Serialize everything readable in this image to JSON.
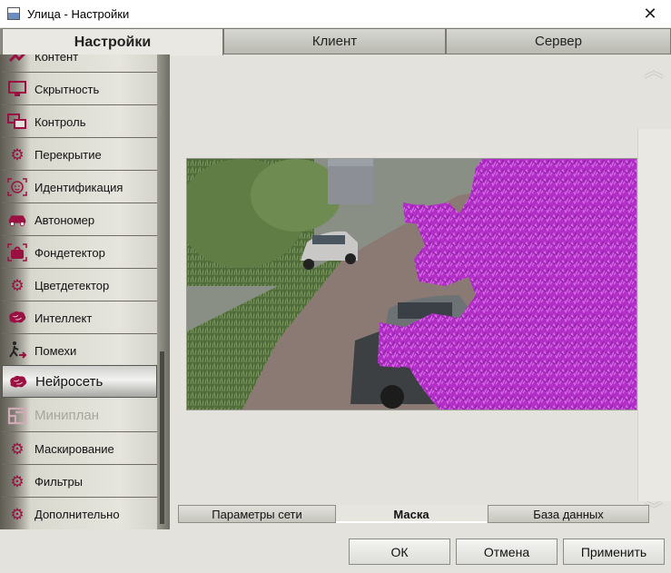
{
  "window": {
    "title": "Улица - Настройки",
    "close_glyph": "✕"
  },
  "top_tabs": [
    {
      "label": "Настройки",
      "active": true
    },
    {
      "label": "Клиент",
      "active": false
    },
    {
      "label": "Сервер",
      "active": false
    }
  ],
  "sidebar": {
    "items": [
      {
        "label": "Контент",
        "icon": "partial-icon",
        "state": "partial"
      },
      {
        "label": "Скрытность",
        "icon": "monitor-icon",
        "state": "normal"
      },
      {
        "label": "Контроль",
        "icon": "screens-icon",
        "state": "normal"
      },
      {
        "label": "Перекрытие",
        "icon": "gear-icon",
        "state": "normal"
      },
      {
        "label": "Идентификация",
        "icon": "face-icon",
        "state": "normal"
      },
      {
        "label": "Автономер",
        "icon": "car-icon",
        "state": "normal"
      },
      {
        "label": "Фондетектор",
        "icon": "bag-icon",
        "state": "normal"
      },
      {
        "label": "Цветдетектор",
        "icon": "gear-icon",
        "state": "normal"
      },
      {
        "label": "Интеллект",
        "icon": "brain-icon",
        "state": "normal"
      },
      {
        "label": "Помехи",
        "icon": "walker-icon",
        "state": "normal"
      },
      {
        "label": "Нейросеть",
        "icon": "brain-icon",
        "state": "active"
      },
      {
        "label": "Миниплан",
        "icon": "plan-icon",
        "state": "disabled"
      },
      {
        "label": "Маскирование",
        "icon": "gear-icon",
        "state": "normal"
      },
      {
        "label": "Фильтры",
        "icon": "gear-icon",
        "state": "normal"
      },
      {
        "label": "Дополнительно",
        "icon": "gear-icon",
        "state": "normal"
      }
    ]
  },
  "sub_tabs": [
    {
      "label": "Параметры сети",
      "active": false
    },
    {
      "label": "Маска",
      "active": true
    },
    {
      "label": "База данных",
      "active": false
    }
  ],
  "buttons": {
    "ok": "ОК",
    "cancel": "Отмена",
    "apply": "Применить"
  },
  "colors": {
    "accent": "#9a1041",
    "mask": "#c23bd8",
    "panel": "#e3e2dc"
  }
}
